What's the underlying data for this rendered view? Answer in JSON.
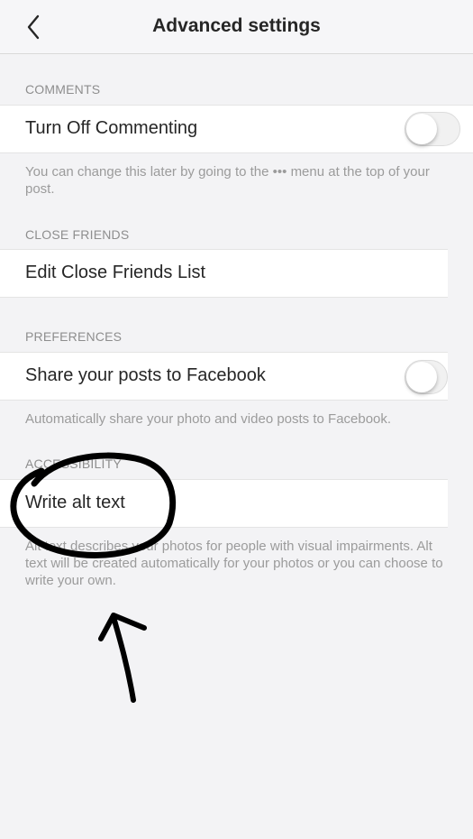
{
  "header": {
    "title": "Advanced settings",
    "back_icon": "chevron-left-icon"
  },
  "comments": {
    "section_label": "COMMENTS",
    "row_label": "Turn Off Commenting",
    "toggle_on": false,
    "help_text": "You can change this later by going to the ••• menu at the top of your post."
  },
  "close_friends": {
    "section_label": "CLOSE FRIENDS",
    "row_label": "Edit Close Friends List"
  },
  "preferences": {
    "section_label": "PREFERENCES",
    "row_label": "Share your posts to Facebook",
    "toggle_on": false,
    "help_text": "Automatically share your photo and video posts to Facebook."
  },
  "accessibility": {
    "section_label": "ACCESSIBILITY",
    "row_label": "Write alt text",
    "help_text": "Alt text describes your photos for people with visual impairments. Alt text will be created automatically for your photos or you can choose to write your own."
  },
  "colors": {
    "background": "#f3f3f5",
    "row_background": "#ffffff",
    "text_primary": "#262626",
    "text_secondary": "#8e8e8e",
    "annotation_ink": "#000000"
  }
}
